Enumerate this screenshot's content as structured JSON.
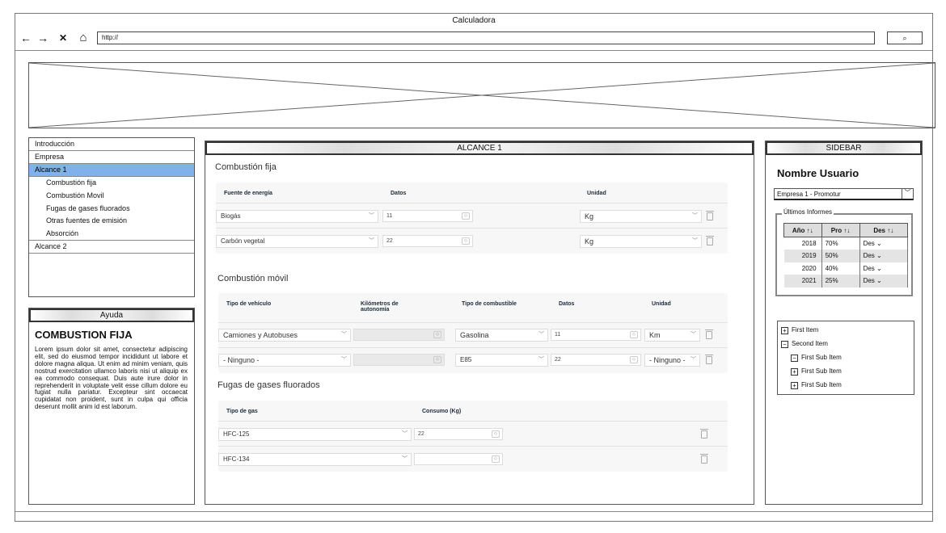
{
  "window": {
    "title": "Calculadora"
  },
  "nav": {
    "back": "←",
    "forward": "→",
    "close": "✕",
    "home": "⌂",
    "url": "http://",
    "search_btn": "⌕"
  },
  "leftnav": {
    "items": [
      {
        "label": "Introducción"
      },
      {
        "label": "Empresa"
      },
      {
        "label": "Alcance 1"
      },
      {
        "label": "Alcance 2"
      }
    ],
    "subitems": [
      "Combustión fija",
      "Combustión Movil",
      "Fugas de gases fluorados",
      "Otras fuentes de emisión",
      "Absorción"
    ]
  },
  "help": {
    "header": "Ayuda",
    "title": "COMBUSTION FIJA",
    "body": "Lorem ipsum dolor sit amet, consectetur adipiscing elit, sed do eiusmod tempor incididunt ut labore et dolore magna aliqua. Ut enim ad minim veniam, quis nostrud exercitation ullamco laboris nisi ut aliquip ex ea commodo consequat. Duis aute irure dolor in reprehenderit in voluptate velit esse cillum dolore eu fugiat nulla pariatur. Excepteur sint occaecat cupidatat non proident, sunt in culpa qui officia deserunt mollit anim id est laborum."
  },
  "main": {
    "header": "ALCANCE 1",
    "fija": {
      "title": "Combustión fija",
      "cols": [
        "Fuente de energía",
        "Datos",
        "Unidad"
      ],
      "rows": [
        {
          "fuente": "Biogás",
          "datos": "11",
          "unidad": "Kg"
        },
        {
          "fuente": "Carbón vegetal",
          "datos": "22",
          "unidad": "Kg"
        }
      ]
    },
    "movil": {
      "title": "Combustión móvil",
      "cols": [
        "Tipo de vehículo",
        "Kilómetros de autonomía",
        "Tipo de combustible",
        "Datos",
        "Unidad"
      ],
      "rows": [
        {
          "vehiculo": "Camiones y Autobuses",
          "km": "",
          "combustible": "Gasolina",
          "datos": "11",
          "unidad": "Km"
        },
        {
          "vehiculo": "- Ninguno -",
          "km": "",
          "combustible": "E85",
          "datos": "22",
          "unidad": "- Ninguno -"
        }
      ]
    },
    "fugas": {
      "title": "Fugas de gases fluorados",
      "cols": [
        "Tipo de gas",
        "Consumo (Kg)"
      ],
      "rows": [
        {
          "gas": "HFC-125",
          "consumo": "22"
        },
        {
          "gas": "HFC-134",
          "consumo": ""
        }
      ]
    }
  },
  "sidebar": {
    "header": "SIDEBAR",
    "user": "Nombre Usuario",
    "company": "Empresa 1 - Promotur",
    "reports_label": "Últimos Informes",
    "report_cols": [
      "Año ↑↓",
      "Pro ↑↓",
      "Des ↑↓"
    ],
    "reports": [
      {
        "year": "2018",
        "pro": "70%",
        "des": "Des"
      },
      {
        "year": "2019",
        "pro": "50%",
        "des": "Des"
      },
      {
        "year": "2020",
        "pro": "40%",
        "des": "Des"
      },
      {
        "year": "2021",
        "pro": "25%",
        "des": "Des"
      }
    ],
    "tree": [
      {
        "label": "First Item",
        "state": "+"
      },
      {
        "label": "Second Item",
        "state": "−"
      },
      {
        "label": "First Sub Item",
        "state": "−"
      },
      {
        "label": "First Sub Item",
        "state": "+"
      },
      {
        "label": "First Sub Item",
        "state": "+"
      }
    ]
  }
}
